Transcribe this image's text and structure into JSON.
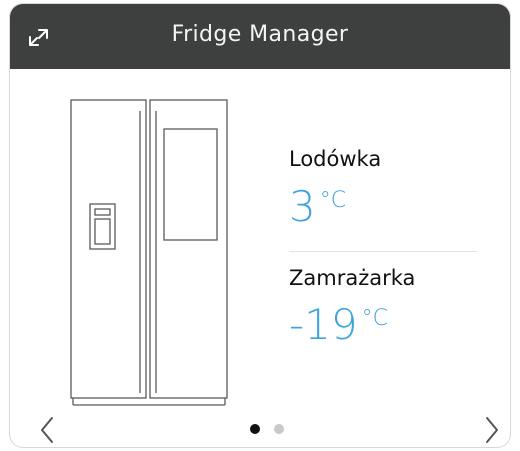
{
  "header": {
    "title": "Fridge Manager",
    "expand_icon": "expand-arrows-icon"
  },
  "fridge": {
    "label": "Lodówka",
    "temperature": "3",
    "unit": "°C"
  },
  "freezer": {
    "label": "Zamrażarka",
    "temperature": "-19",
    "unit": "°C"
  },
  "pagination": {
    "total_pages": 2,
    "current_page": 1,
    "prev_icon": "chevron-left-icon",
    "next_icon": "chevron-right-icon"
  },
  "colors": {
    "header_bg": "#3e403f",
    "temperature": "#3ea3dd",
    "dot_active": "#111111",
    "dot_inactive": "#c8c8c8"
  }
}
